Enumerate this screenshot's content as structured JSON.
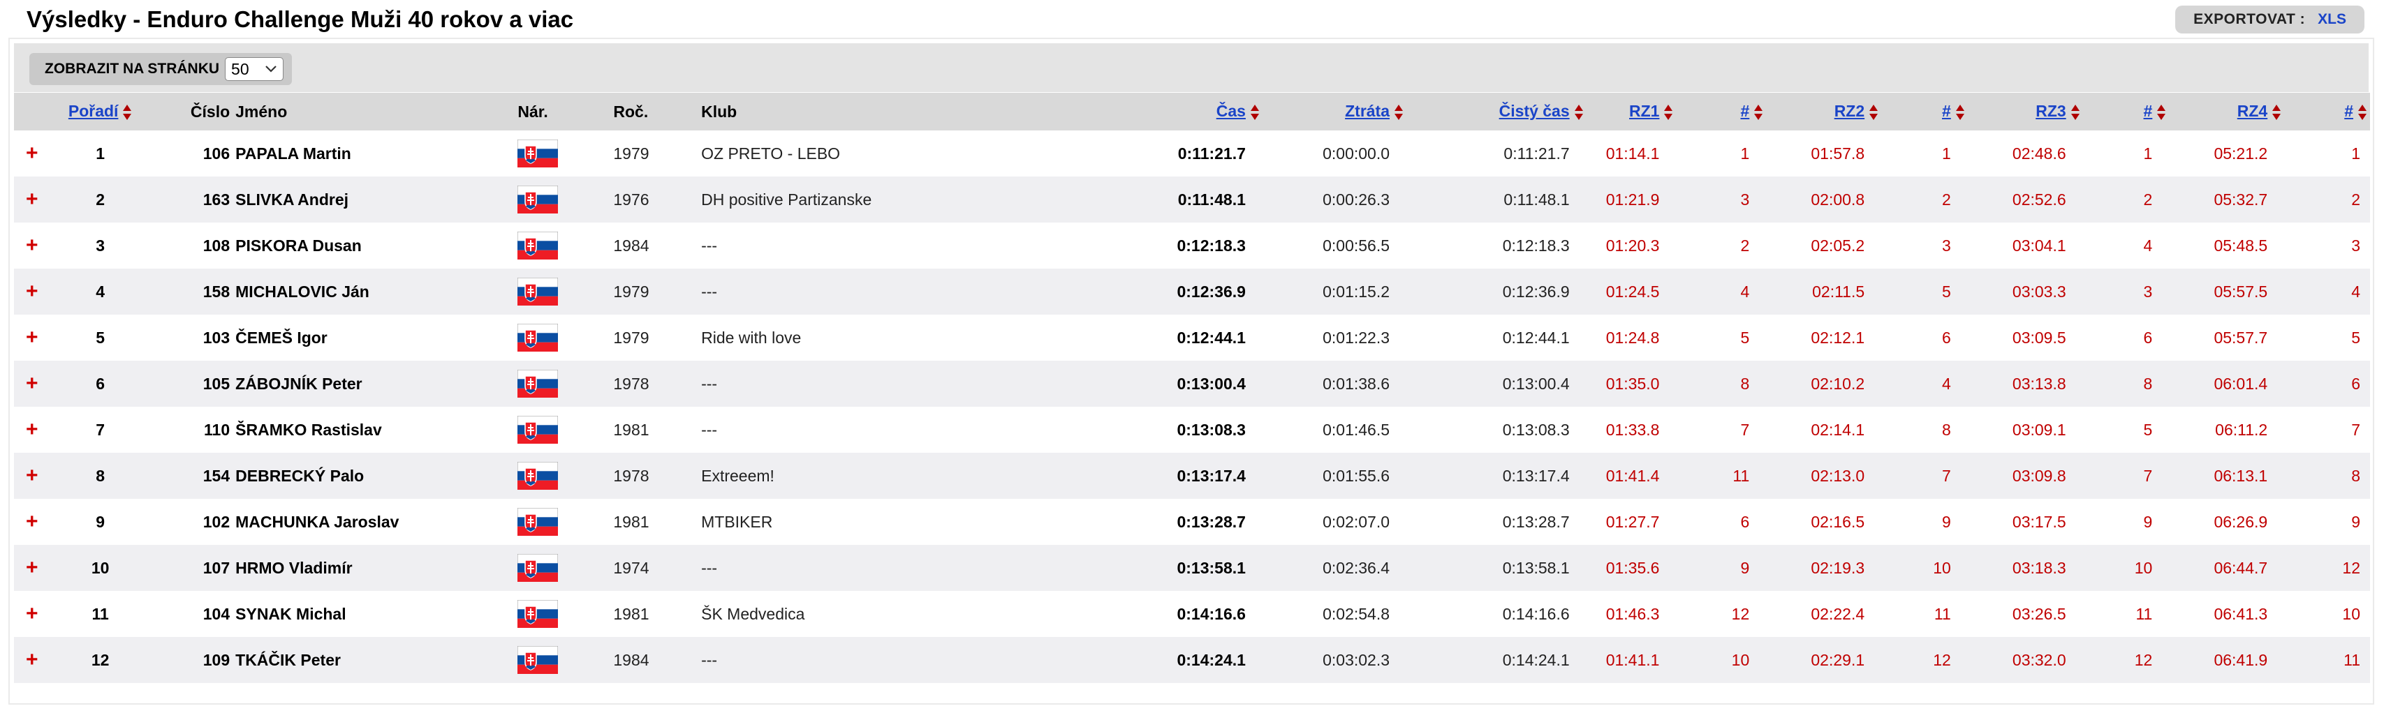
{
  "page": {
    "title": "Výsledky - Enduro Challenge Muži 40 rokov a viac",
    "export_label": "EXPORTOVAT :",
    "export_xls": "XLS",
    "pager_label": "ZOBRAZIT NA STRÁNKU",
    "pager_value": "50"
  },
  "columns": {
    "poradi": "Pořadí",
    "cislo": "Číslo",
    "jmeno": "Jméno",
    "nar": "Nár.",
    "roc": "Roč.",
    "klub": "Klub",
    "cas": "Čas",
    "ztrata": "Ztráta",
    "cisty": "Čistý čas",
    "rz1": "RZ1",
    "n1": "#",
    "rz2": "RZ2",
    "n2": "#",
    "rz3": "RZ3",
    "n3": "#",
    "rz4": "RZ4",
    "n4": "#"
  },
  "expand_symbol": "+",
  "colors": {
    "link": "#1a44c8",
    "stage_time": "#c00000",
    "expand": "#d00000",
    "row_alt": "#efeff2"
  },
  "rows": [
    {
      "poradi": "1",
      "cislo": "106",
      "jmeno": "PAPALA Martin",
      "nar": "flag-sk",
      "roc": "1979",
      "klub": "OZ PRETO - LEBO",
      "cas": "0:11:21.7",
      "ztrata": "0:00:00.0",
      "cisty": "0:11:21.7",
      "rz1": "01:14.1",
      "n1": "1",
      "rz2": "01:57.8",
      "n2": "1",
      "rz3": "02:48.6",
      "n3": "1",
      "rz4": "05:21.2",
      "n4": "1"
    },
    {
      "poradi": "2",
      "cislo": "163",
      "jmeno": "SLIVKA Andrej",
      "nar": "flag-sk",
      "roc": "1976",
      "klub": "DH positive Partizanske",
      "cas": "0:11:48.1",
      "ztrata": "0:00:26.3",
      "cisty": "0:11:48.1",
      "rz1": "01:21.9",
      "n1": "3",
      "rz2": "02:00.8",
      "n2": "2",
      "rz3": "02:52.6",
      "n3": "2",
      "rz4": "05:32.7",
      "n4": "2"
    },
    {
      "poradi": "3",
      "cislo": "108",
      "jmeno": "PISKORA Dusan",
      "nar": "flag-sk",
      "roc": "1984",
      "klub": "---",
      "cas": "0:12:18.3",
      "ztrata": "0:00:56.5",
      "cisty": "0:12:18.3",
      "rz1": "01:20.3",
      "n1": "2",
      "rz2": "02:05.2",
      "n2": "3",
      "rz3": "03:04.1",
      "n3": "4",
      "rz4": "05:48.5",
      "n4": "3"
    },
    {
      "poradi": "4",
      "cislo": "158",
      "jmeno": "MICHALOVIC Ján",
      "nar": "flag-sk",
      "roc": "1979",
      "klub": "---",
      "cas": "0:12:36.9",
      "ztrata": "0:01:15.2",
      "cisty": "0:12:36.9",
      "rz1": "01:24.5",
      "n1": "4",
      "rz2": "02:11.5",
      "n2": "5",
      "rz3": "03:03.3",
      "n3": "3",
      "rz4": "05:57.5",
      "n4": "4"
    },
    {
      "poradi": "5",
      "cislo": "103",
      "jmeno": "ČEMEŠ Igor",
      "nar": "flag-sk",
      "roc": "1979",
      "klub": "Ride with love",
      "cas": "0:12:44.1",
      "ztrata": "0:01:22.3",
      "cisty": "0:12:44.1",
      "rz1": "01:24.8",
      "n1": "5",
      "rz2": "02:12.1",
      "n2": "6",
      "rz3": "03:09.5",
      "n3": "6",
      "rz4": "05:57.7",
      "n4": "5"
    },
    {
      "poradi": "6",
      "cislo": "105",
      "jmeno": "ZÁBOJNÍK Peter",
      "nar": "flag-sk",
      "roc": "1978",
      "klub": "---",
      "cas": "0:13:00.4",
      "ztrata": "0:01:38.6",
      "cisty": "0:13:00.4",
      "rz1": "01:35.0",
      "n1": "8",
      "rz2": "02:10.2",
      "n2": "4",
      "rz3": "03:13.8",
      "n3": "8",
      "rz4": "06:01.4",
      "n4": "6"
    },
    {
      "poradi": "7",
      "cislo": "110",
      "jmeno": "ŠRAMKO Rastislav",
      "nar": "flag-sk",
      "roc": "1981",
      "klub": "---",
      "cas": "0:13:08.3",
      "ztrata": "0:01:46.5",
      "cisty": "0:13:08.3",
      "rz1": "01:33.8",
      "n1": "7",
      "rz2": "02:14.1",
      "n2": "8",
      "rz3": "03:09.1",
      "n3": "5",
      "rz4": "06:11.2",
      "n4": "7"
    },
    {
      "poradi": "8",
      "cislo": "154",
      "jmeno": "DEBRECKÝ Palo",
      "nar": "flag-sk",
      "roc": "1978",
      "klub": "Extreeem!",
      "cas": "0:13:17.4",
      "ztrata": "0:01:55.6",
      "cisty": "0:13:17.4",
      "rz1": "01:41.4",
      "n1": "11",
      "rz2": "02:13.0",
      "n2": "7",
      "rz3": "03:09.8",
      "n3": "7",
      "rz4": "06:13.1",
      "n4": "8"
    },
    {
      "poradi": "9",
      "cislo": "102",
      "jmeno": "MACHUNKA Jaroslav",
      "nar": "flag-sk",
      "roc": "1981",
      "klub": "MTBIKER",
      "cas": "0:13:28.7",
      "ztrata": "0:02:07.0",
      "cisty": "0:13:28.7",
      "rz1": "01:27.7",
      "n1": "6",
      "rz2": "02:16.5",
      "n2": "9",
      "rz3": "03:17.5",
      "n3": "9",
      "rz4": "06:26.9",
      "n4": "9"
    },
    {
      "poradi": "10",
      "cislo": "107",
      "jmeno": "HRMO Vladimír",
      "nar": "flag-sk",
      "roc": "1974",
      "klub": "---",
      "cas": "0:13:58.1",
      "ztrata": "0:02:36.4",
      "cisty": "0:13:58.1",
      "rz1": "01:35.6",
      "n1": "9",
      "rz2": "02:19.3",
      "n2": "10",
      "rz3": "03:18.3",
      "n3": "10",
      "rz4": "06:44.7",
      "n4": "12"
    },
    {
      "poradi": "11",
      "cislo": "104",
      "jmeno": "SYNAK Michal",
      "nar": "flag-sk",
      "roc": "1981",
      "klub": "ŠK Medvedica",
      "cas": "0:14:16.6",
      "ztrata": "0:02:54.8",
      "cisty": "0:14:16.6",
      "rz1": "01:46.3",
      "n1": "12",
      "rz2": "02:22.4",
      "n2": "11",
      "rz3": "03:26.5",
      "n3": "11",
      "rz4": "06:41.3",
      "n4": "10"
    },
    {
      "poradi": "12",
      "cislo": "109",
      "jmeno": "TKÁČIK Peter",
      "nar": "flag-sk",
      "roc": "1984",
      "klub": "---",
      "cas": "0:14:24.1",
      "ztrata": "0:03:02.3",
      "cisty": "0:14:24.1",
      "rz1": "01:41.1",
      "n1": "10",
      "rz2": "02:29.1",
      "n2": "12",
      "rz3": "03:32.0",
      "n3": "12",
      "rz4": "06:41.9",
      "n4": "11"
    }
  ]
}
